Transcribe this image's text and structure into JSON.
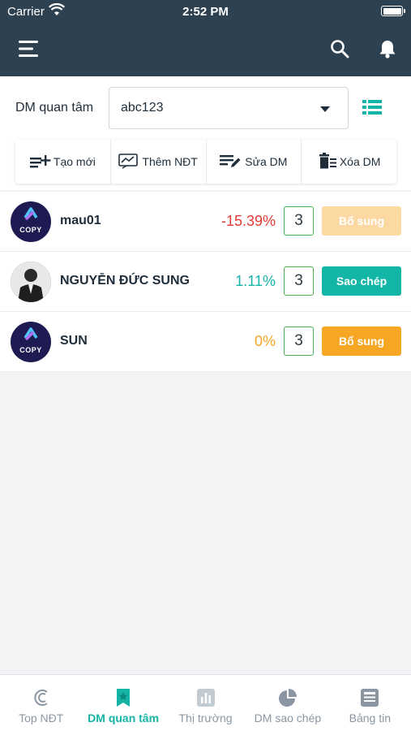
{
  "status_bar": {
    "carrier": "Carrier",
    "time": "2:52 PM"
  },
  "header": {
    "icons": [
      "menu-icon",
      "search-icon",
      "bell-icon"
    ]
  },
  "filter": {
    "label": "DM quan tâm",
    "selected": "abc123"
  },
  "toolbar": {
    "items": [
      {
        "label": "Tạo mới",
        "icon": "add-list-icon"
      },
      {
        "label": "Thêm NĐT",
        "icon": "chart-add-icon"
      },
      {
        "label": "Sửa DM",
        "icon": "edit-list-icon"
      },
      {
        "label": "Xóa DM",
        "icon": "trash-icon"
      }
    ]
  },
  "investors": [
    {
      "name": "mau01",
      "change": "-15.39%",
      "count": "3",
      "action": "Bổ sung",
      "avatar": "copy-logo",
      "change_color": "#e53935",
      "action_color": "#fcd9a3"
    },
    {
      "name": "NGUYỄN ĐỨC SUNG",
      "change": "1.11%",
      "count": "3",
      "action": "Sao chép",
      "avatar": "photo",
      "change_color": "#12b5a6",
      "action_color": "#12b5a6"
    },
    {
      "name": "SUN",
      "change": "0%",
      "count": "3",
      "action": "Bổ sung",
      "avatar": "copy-logo",
      "change_color": "#f5a623",
      "action_color": "#f5a623"
    }
  ],
  "avatar_text": "COPY",
  "bottom_nav": [
    {
      "label": "Top NĐT",
      "icon": "top-investor-icon"
    },
    {
      "label": "DM quan tâm",
      "icon": "bookmark-icon",
      "active": true
    },
    {
      "label": "Thị trường",
      "icon": "bar-chart-icon"
    },
    {
      "label": "DM sao chép",
      "icon": "pie-chart-icon"
    },
    {
      "label": "Bảng tin",
      "icon": "news-icon"
    }
  ],
  "colors": {
    "header": "#2d4150",
    "accent": "#12b5a6",
    "orange": "#f5a623",
    "red": "#e53935"
  }
}
